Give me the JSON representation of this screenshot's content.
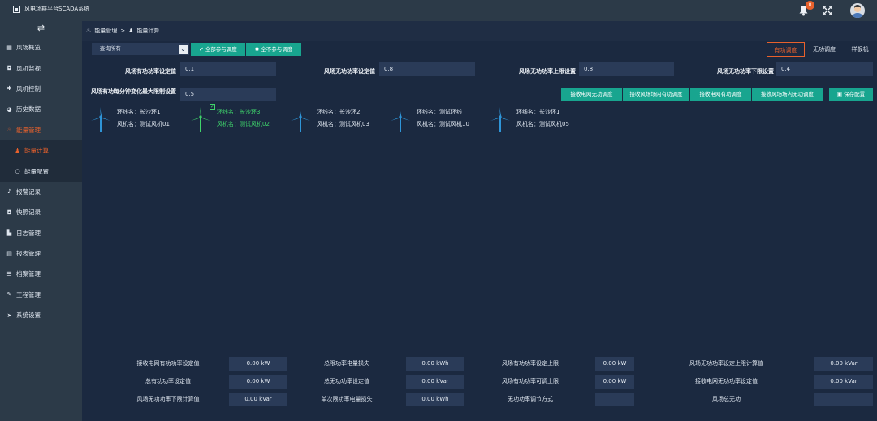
{
  "app": {
    "title": "风电场群平台SCADA系统",
    "notification_count": "0"
  },
  "sidebar": {
    "items": [
      {
        "icon": "grid-icon",
        "label": "风场概览"
      },
      {
        "icon": "camera-icon",
        "label": "风机监视"
      },
      {
        "icon": "gear-icon",
        "label": "风机控制"
      },
      {
        "icon": "history-icon",
        "label": "历史数据"
      },
      {
        "icon": "energy-icon",
        "label": "能量管理"
      },
      {
        "icon": "user-icon",
        "label": "能量计算"
      },
      {
        "icon": "circle-icon",
        "label": "能量配置"
      },
      {
        "icon": "bell-icon",
        "label": "报警记录"
      },
      {
        "icon": "camera-icon",
        "label": "快照记录"
      },
      {
        "icon": "file-icon",
        "label": "日志管理"
      },
      {
        "icon": "table-icon",
        "label": "报表管理"
      },
      {
        "icon": "list-icon",
        "label": "档案管理"
      },
      {
        "icon": "wrench-icon",
        "label": "工程管理"
      },
      {
        "icon": "send-icon",
        "label": "系统设置"
      }
    ]
  },
  "breadcrumb": {
    "parent": "能量管理",
    "separator": ">",
    "current": "能量计算"
  },
  "toolbar": {
    "query_select": "--查询所有--",
    "all_join_label": "全部参与调度",
    "all_exclude_label": "全不参与调度"
  },
  "tabs": [
    "有功调度",
    "无功调度",
    "样板机"
  ],
  "settings": {
    "active_power_setpoint": {
      "label": "风场有功功率设定值",
      "value": "0.1"
    },
    "reactive_power_setpoint": {
      "label": "风场无功功率设定值",
      "value": "0.8"
    },
    "reactive_upper_limit": {
      "label": "风场无功功率上限设置",
      "value": "0.8"
    },
    "reactive_lower_limit": {
      "label": "风场无功功率下限设置",
      "value": "0.4"
    },
    "active_ramp_limit": {
      "label": "风场有功每分钟变化最大限制设置",
      "value": "0.5"
    }
  },
  "commands": [
    "接收电网无功调度",
    "接收风场场内有功调度",
    "接收电网有功调度",
    "接收风场场内无功调度",
    "保存配置"
  ],
  "turbines": [
    {
      "ring_label": "环线名：长沙环1",
      "name_label": "风机名：测试风机01",
      "selected": false
    },
    {
      "ring_label": "环线名：长沙环3",
      "name_label": "风机名：测试风机02",
      "selected": true
    },
    {
      "ring_label": "环线名：长沙环2",
      "name_label": "风机名：测试风机03",
      "selected": false
    },
    {
      "ring_label": "环线名：测试环线",
      "name_label": "风机名：测试风机10",
      "selected": false
    },
    {
      "ring_label": "环线名：长沙环1",
      "name_label": "风机名：测试风机05",
      "selected": false
    }
  ],
  "summary": {
    "rows": [
      [
        {
          "label": "接收电网有功功率设定值",
          "value": "0.00 kW"
        },
        {
          "label": "总限功率电量损失",
          "value": "0.00 kWh"
        },
        {
          "label": "风场有功功率设定上限",
          "value": "0.00 kW"
        },
        {
          "label": "风场无功功率设定上限计算值",
          "value": "0.00 kVar"
        }
      ],
      [
        {
          "label": "总有功功率设定值",
          "value": "0.00 kW"
        },
        {
          "label": "总无功功率设定值",
          "value": "0.00 kVar"
        },
        {
          "label": "风场有功功率可调上限",
          "value": "0.00 kW"
        },
        {
          "label": "接收电网无功功率设定值",
          "value": "0.00 kVar"
        }
      ],
      [
        {
          "label": "风场无功功率下限计算值",
          "value": "0.00 kVar"
        },
        {
          "label": "单次限功率电量损失",
          "value": "0.00 kWh"
        },
        {
          "label": "无功功率调节方式",
          "value": ""
        },
        {
          "label": "风场总无功",
          "value": ""
        }
      ]
    ]
  },
  "colors": {
    "accent": "#e8612c",
    "primary_button": "#18a58f",
    "selected_turbine": "#3fd46b",
    "turbine_blue": "#2f95d8"
  }
}
